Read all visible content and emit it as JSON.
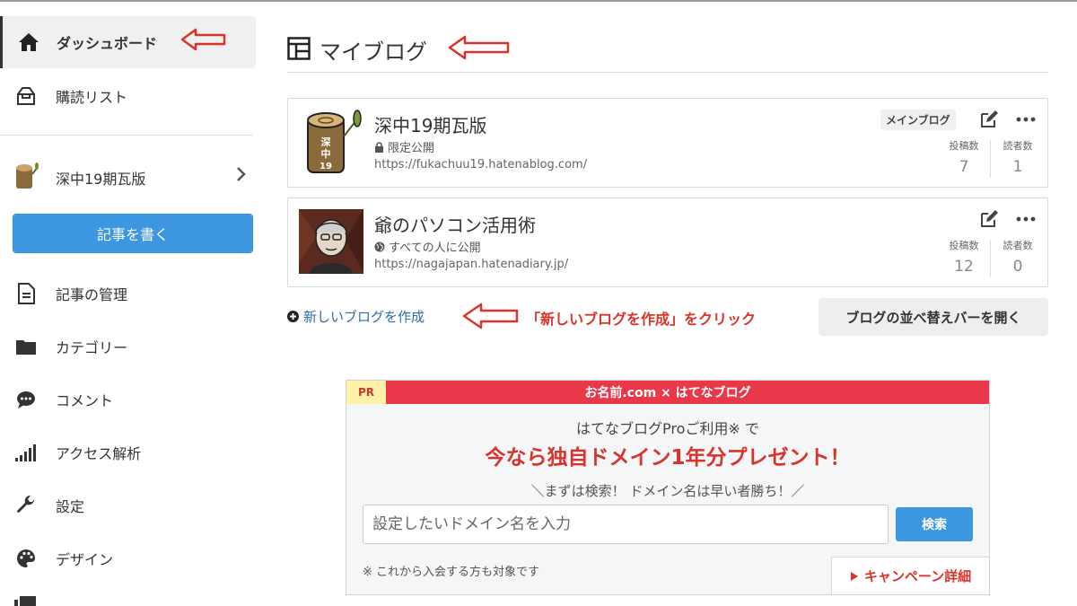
{
  "sidebar": {
    "items": [
      {
        "label": "ダッシュボード",
        "icon": "home-icon"
      },
      {
        "label": "購読リスト",
        "icon": "inbox-icon"
      },
      {
        "label": "記事の管理",
        "icon": "document-icon"
      },
      {
        "label": "カテゴリー",
        "icon": "folder-icon"
      },
      {
        "label": "コメント",
        "icon": "comment-icon"
      },
      {
        "label": "アクセス解析",
        "icon": "bar-chart-icon"
      },
      {
        "label": "設定",
        "icon": "wrench-icon"
      },
      {
        "label": "デザイン",
        "icon": "palette-icon"
      }
    ],
    "blog_switch": {
      "label": "深中19期瓦版",
      "icon": "chevron-right-icon"
    },
    "write_button": "記事を書く"
  },
  "main": {
    "title": "マイブログ",
    "blogs": [
      {
        "name": "深中19期瓦版",
        "visibility": "限定公開",
        "visibility_icon": "lock-icon",
        "url": "https://fukachuu19.hatenablog.com/",
        "badge": "メインブログ",
        "posts_label": "投稿数",
        "posts": "7",
        "readers_label": "読者数",
        "readers": "1"
      },
      {
        "name": "爺のパソコン活用術",
        "visibility": "すべての人に公開",
        "visibility_icon": "globe-icon",
        "url": "https://nagajapan.hatenadiary.jp/",
        "badge": "",
        "posts_label": "投稿数",
        "posts": "12",
        "readers_label": "読者数",
        "readers": "0"
      }
    ],
    "new_blog_link": "新しいブログを作成",
    "annotation": "「新しいブログを作成」をクリック",
    "sort_button": "ブログの並べ替えバーを開く"
  },
  "ad": {
    "pr": "PR",
    "header": "お名前.com × はてなブログ",
    "line1": "はてなブログProご利用※ で",
    "line2": "今なら独自ドメイン1年分プレゼント！",
    "line3": "＼まずは検索！ ドメイン名は早い者勝ち！／",
    "input_placeholder": "設定したいドメイン名を入力",
    "search_button": "検索",
    "note": "※ これから入会する方も対象です",
    "detail_link": "キャンペーン詳細"
  },
  "colors": {
    "accent_blue": "#3d96e0",
    "annotation_red": "#d9342b",
    "ad_header_red": "#e8384a",
    "link_blue": "#2e6da4"
  }
}
